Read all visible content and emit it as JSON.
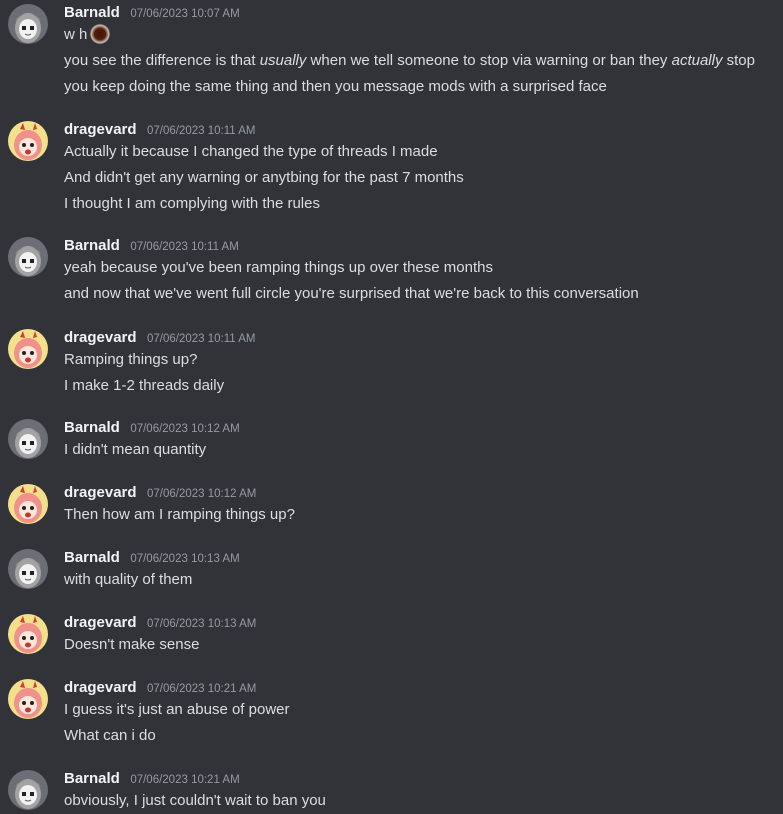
{
  "users": {
    "barnald": "Barnald",
    "dragevard": "dragevard"
  },
  "avatars": {
    "barnald": {
      "style": "gray-haired anime girl",
      "bg": "#6b6e74",
      "hair": "#9a9a9a"
    },
    "dragevard": {
      "style": "pink-haired anime girl",
      "bg": "#f4e08a",
      "hair": "#f0918b"
    }
  },
  "messages": [
    {
      "author": "Barnald",
      "time": "07/06/2023 10:07 AM",
      "lines": [
        {
          "parts": [
            "w h"
          ]
        },
        {
          "parts": [
            "you see the difference is that ",
            "usually",
            " when we tell someone to stop via warning or ban they ",
            "actually",
            " stop"
          ]
        },
        {
          "parts": [
            "you keep doing the same thing and then you message mods with a surprised face"
          ]
        }
      ]
    },
    {
      "author": "dragevard",
      "time": "07/06/2023 10:11 AM",
      "lines": [
        {
          "parts": [
            "Actually it because I changed the type of threads I made"
          ]
        },
        {
          "parts": [
            "And didn't get any warning or anytbing for the past 7 months"
          ]
        },
        {
          "parts": [
            "I thought I am complying with the rules"
          ]
        }
      ]
    },
    {
      "author": "Barnald",
      "time": "07/06/2023 10:11 AM",
      "lines": [
        {
          "parts": [
            "yeah because you've been ramping things up over these months"
          ]
        },
        {
          "parts": [
            "and now that we've went full circle you're surprised that we're back to this conversation"
          ]
        }
      ]
    },
    {
      "author": "dragevard",
      "time": "07/06/2023 10:11 AM",
      "lines": [
        {
          "parts": [
            "Ramping things up?"
          ]
        },
        {
          "parts": [
            "I make 1-2 threads daily"
          ]
        }
      ]
    },
    {
      "author": "Barnald",
      "time": "07/06/2023 10:12 AM",
      "lines": [
        {
          "parts": [
            "I didn't mean quantity"
          ]
        }
      ]
    },
    {
      "author": "dragevard",
      "time": "07/06/2023 10:12 AM",
      "lines": [
        {
          "parts": [
            "Then how am I ramping things up?"
          ]
        }
      ]
    },
    {
      "author": "Barnald",
      "time": "07/06/2023 10:13 AM",
      "lines": [
        {
          "parts": [
            "with quality of them"
          ]
        }
      ]
    },
    {
      "author": "dragevard",
      "time": "07/06/2023 10:13 AM",
      "lines": [
        {
          "parts": [
            "Doesn't make sense"
          ]
        }
      ]
    },
    {
      "author": "dragevard",
      "time": "07/06/2023 10:21 AM",
      "lines": [
        {
          "parts": [
            "I guess it's just an abuse of power"
          ]
        },
        {
          "parts": [
            "What can i do"
          ]
        }
      ]
    },
    {
      "author": "Barnald",
      "time": "07/06/2023 10:21 AM",
      "lines": [
        {
          "parts": [
            "obviously, I just couldn't wait to ban you"
          ]
        }
      ]
    }
  ],
  "emoji": {
    "name": "surprised-face-emoji"
  }
}
